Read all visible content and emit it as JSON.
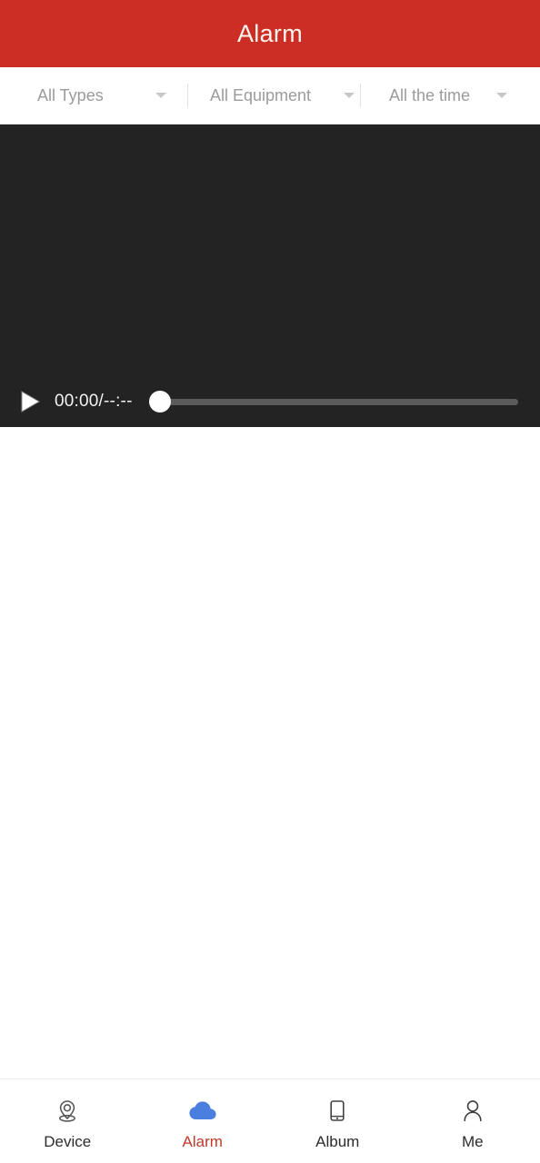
{
  "header": {
    "title": "Alarm",
    "background_color": "#cc2d24",
    "title_color": "#fdf6ef"
  },
  "filters": [
    {
      "label": "All Types",
      "icon": "chevron-down-icon"
    },
    {
      "label": "All Equipment",
      "icon": "chevron-down-icon"
    },
    {
      "label": "All the time",
      "icon": "chevron-down-icon"
    }
  ],
  "player": {
    "background_color": "#232323",
    "play_icon": "play-icon",
    "time_readout": "00:00/--:--",
    "current_time": "00:00",
    "total_time": "--:--",
    "progress_percent": 0,
    "track_color": "#5a5a5a",
    "thumb_color": "#ffffff"
  },
  "bottom_nav": {
    "active_color": "#c0392b",
    "items": [
      {
        "label": "Device",
        "icon": "location-pin-icon",
        "active": false
      },
      {
        "label": "Alarm",
        "icon": "cloud-icon",
        "active": true
      },
      {
        "label": "Album",
        "icon": "phone-icon",
        "active": false
      },
      {
        "label": "Me",
        "icon": "person-icon",
        "active": false
      }
    ]
  }
}
